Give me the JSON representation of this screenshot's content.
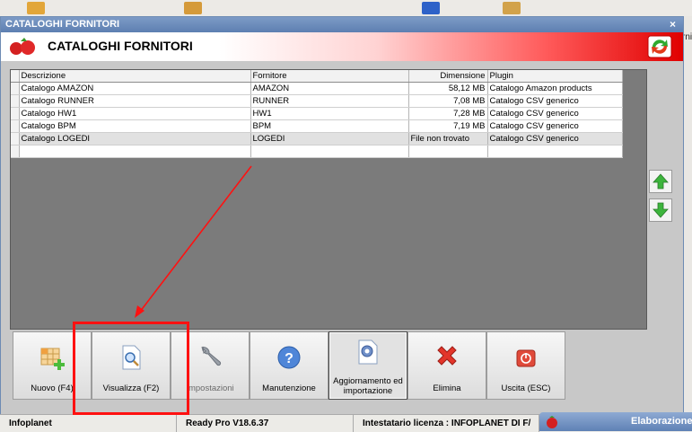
{
  "window": {
    "title": "CATALOGHI FORNITORI",
    "close": "×"
  },
  "header": {
    "title": "CATALOGHI FORNITORI"
  },
  "background": {
    "right_text": "rni"
  },
  "grid": {
    "columns": [
      "Descrizione",
      "Fornitore",
      "Dimensione",
      "Plugin"
    ],
    "rows": [
      [
        "Catalogo AMAZON",
        "AMAZON",
        "58,12 MB",
        "Catalogo Amazon products"
      ],
      [
        "Catalogo RUNNER",
        "RUNNER",
        "7,08 MB",
        "Catalogo CSV generico"
      ],
      [
        "Catalogo HW1",
        "HW1",
        "7,28 MB",
        "Catalogo CSV generico"
      ],
      [
        "Catalogo BPM",
        "BPM",
        "7,19 MB",
        "Catalogo CSV generico"
      ],
      [
        "Catalogo LOGEDI",
        "LOGEDI",
        "File non trovato",
        "Catalogo CSV generico"
      ]
    ]
  },
  "toolbar": {
    "nuovo": "Nuovo (F4)",
    "visualizza": "Visualizza (F2)",
    "impostazioni": "Impostazioni",
    "manutenzione": "Manutenzione",
    "aggiornamento_1": "Aggiornamento ed",
    "aggiornamento_2": "importazione",
    "elimina": "Elimina",
    "uscita": "Uscita (ESC)"
  },
  "statusbar": {
    "company": "Infoplanet",
    "version": "Ready Pro V18.6.37",
    "license": "Intestatario licenza : INFOPLANET DI F/",
    "elaborazione": "Elaborazione"
  },
  "colors": {
    "accent_red": "#ff1111",
    "title_blue": "#5d7fb1"
  }
}
